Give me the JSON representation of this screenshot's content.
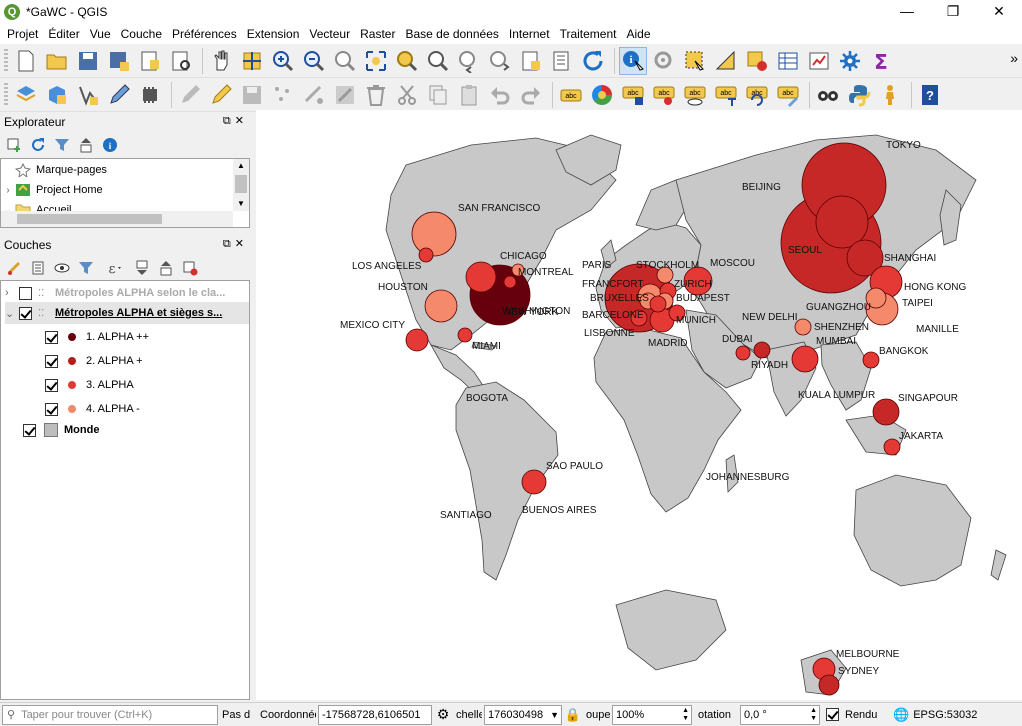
{
  "window": {
    "title": "*GaWC - QGIS",
    "controls": [
      "minimize-icon",
      "maximize-icon",
      "close-icon"
    ]
  },
  "menu": [
    "Projet",
    "Éditer",
    "Vue",
    "Couche",
    "Préférences",
    "Extension",
    "Vecteur",
    "Raster",
    "Base de données",
    "Internet",
    "Traitement",
    "Aide"
  ],
  "toolbar1": [
    "new-project-icon",
    "open-project-icon",
    "save-project-icon",
    "save-as-icon",
    "print-layout-icon",
    "layout-manager-icon",
    "pan-icon",
    "pan-to-selection-icon",
    "zoom-in-icon",
    "zoom-out-icon",
    "zoom-native-icon",
    "zoom-full-icon",
    "zoom-selection-icon",
    "zoom-layer-icon",
    "zoom-last-icon",
    "zoom-next-icon",
    "new-bookmark-icon",
    "show-bookmarks-icon",
    "refresh-icon",
    "identify-icon",
    "action-icon",
    "select-feature-icon",
    "select-value-icon",
    "deselect-icon",
    "attribute-table-icon",
    "statistics-icon",
    "toolbox-icon",
    "sum-icon"
  ],
  "toolbar2": [
    "new-shapefile-icon",
    "new-geopackage-icon",
    "digitize-icon",
    "pencil-icon",
    "plugin-icon",
    "edit-icon",
    "toggle-edit-icon",
    "save-edits-icon",
    "add-feature-icon",
    "vertex-tool-icon",
    "modify-attributes-icon",
    "delete-icon",
    "cut-icon",
    "copy-icon",
    "paste-icon",
    "undo-icon",
    "redo-icon",
    "label-icon",
    "layer-labeling-icon",
    "highlight-label-icon",
    "pin-label-icon",
    "show-label-icon",
    "move-label-icon",
    "rotate-label-icon",
    "change-label-icon",
    "plugin-manager-icon",
    "python-icon",
    "user-icon",
    "help-icon"
  ],
  "browser": {
    "title": "Explorateur",
    "items": [
      {
        "label": "Marque-pages",
        "expanded": false
      },
      {
        "label": "Project Home",
        "expanded": false
      },
      {
        "label": "Accueil",
        "expanded": true
      }
    ]
  },
  "layers": {
    "title": "Couches",
    "items": [
      {
        "label": "Métropoles ALPHA selon le cla...",
        "checked": false,
        "bold": true,
        "muted": true
      },
      {
        "label": "Métropoles ALPHA et sièges s...",
        "checked": true,
        "bold": true,
        "muted": false
      },
      {
        "label": "1. ALPHA ++",
        "checked": true,
        "color": "#67000d"
      },
      {
        "label": "2. ALPHA +",
        "checked": true,
        "color": "#b71c1c"
      },
      {
        "label": "3. ALPHA",
        "checked": true,
        "color": "#e53935"
      },
      {
        "label": "4. ALPHA -",
        "checked": true,
        "color": "#f08a6f"
      },
      {
        "label": "Monde",
        "checked": true,
        "bold": true,
        "color": "#bdbdbd"
      }
    ]
  },
  "map": {
    "land_color": "#c8c8c8",
    "cities": [
      {
        "name": "TOKYO",
        "cls": 2,
        "r": 42
      },
      {
        "name": "BEIJING",
        "cls": 2,
        "r": 26
      },
      {
        "name": "SEOUL",
        "cls": 2,
        "r": 50
      },
      {
        "name": "SHANGHAI",
        "cls": 2,
        "r": 18
      },
      {
        "name": "HONG KONG",
        "cls": 3,
        "r": 16
      },
      {
        "name": "TAIPEI",
        "cls": 4,
        "r": 16
      },
      {
        "name": "GUANGZHOU",
        "cls": 4,
        "r": 10
      },
      {
        "name": "MANILLE",
        "cls": 3,
        "r": 0
      },
      {
        "name": "SHENZHEN",
        "cls": 4,
        "r": 8
      },
      {
        "name": "MUMBAI",
        "cls": 3,
        "r": 13
      },
      {
        "name": "NEW DELHI",
        "cls": 3,
        "r": 0
      },
      {
        "name": "BANGKOK",
        "cls": 3,
        "r": 8
      },
      {
        "name": "KUALA LUMPUR",
        "cls": 3,
        "r": 0
      },
      {
        "name": "SINGAPOUR",
        "cls": 2,
        "r": 13
      },
      {
        "name": "JAKARTA",
        "cls": 3,
        "r": 8
      },
      {
        "name": "DUBAI",
        "cls": 3,
        "r": 7
      },
      {
        "name": "RIYADH",
        "cls": 2,
        "r": 8
      },
      {
        "name": "MOSCOU",
        "cls": 3,
        "r": 14
      },
      {
        "name": "STOCKHOLM",
        "cls": 4,
        "r": 8
      },
      {
        "name": "PARIS",
        "cls": 2,
        "r": 34
      },
      {
        "name": "FRANCFORT",
        "cls": 4,
        "r": 12
      },
      {
        "name": "BRUXELLES",
        "cls": 4,
        "r": 8
      },
      {
        "name": "ZURICH",
        "cls": 3,
        "r": 8
      },
      {
        "name": "BUDAPEST",
        "cls": 4,
        "r": 8
      },
      {
        "name": "MUNICH",
        "cls": 3,
        "r": 8
      },
      {
        "name": "BARCELONE",
        "cls": 3,
        "r": 8
      },
      {
        "name": "MADRID",
        "cls": 3,
        "r": 12
      },
      {
        "name": "LISBONNE",
        "cls": 3,
        "r": 8
      },
      {
        "name": "NEW YORK",
        "cls": 1,
        "r": 30
      },
      {
        "name": "WASHINGTON",
        "cls": 3,
        "r": 6
      },
      {
        "name": "MONTREAL",
        "cls": 4,
        "r": 6
      },
      {
        "name": "CHICAGO",
        "cls": 3,
        "r": 15
      },
      {
        "name": "SAN FRANCISCO",
        "cls": 4,
        "r": 22
      },
      {
        "name": "LOS ANGELES",
        "cls": 3,
        "r": 7
      },
      {
        "name": "HOUSTON",
        "cls": 4,
        "r": 16
      },
      {
        "name": "MEXICO CITY",
        "cls": 3,
        "r": 11
      },
      {
        "name": "MIAMI",
        "cls": 3,
        "r": 7
      },
      {
        "name": "BOGOTA",
        "cls": 3,
        "r": 0
      },
      {
        "name": "SAO PAULO",
        "cls": 3,
        "r": 12
      },
      {
        "name": "BUENOS AIRES",
        "cls": 3,
        "r": 0
      },
      {
        "name": "SANTIAGO",
        "cls": 3,
        "r": 0
      },
      {
        "name": "JOHANNESBURG",
        "cls": 3,
        "r": 0
      },
      {
        "name": "MELBOURNE",
        "cls": 3,
        "r": 11
      },
      {
        "name": "SYDNEY",
        "cls": 2,
        "r": 10
      }
    ]
  },
  "status": {
    "locator_placeholder": "Taper pour trouver (Ctrl+K)",
    "pas_label": "Pas d",
    "coord_label": "Coordonnée",
    "coord_value": "-17568728,6106501",
    "scale_label": "chelle",
    "scale_value": "176030498",
    "magnifier_label": "oupe",
    "magnifier_value": "100%",
    "rotation_label": "otation",
    "rotation_value": "0,0 °",
    "render_label": "Rendu",
    "crs": "EPSG:53032"
  }
}
